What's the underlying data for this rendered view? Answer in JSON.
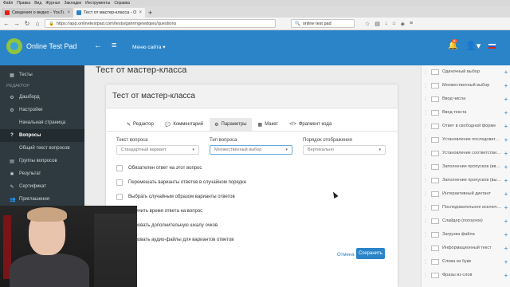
{
  "browser": {
    "menu": [
      "Файл",
      "Правка",
      "Вид",
      "Журнал",
      "Закладки",
      "Инструменты",
      "Справка"
    ],
    "tabs": [
      {
        "title": "Сведения о видео - YouTube S",
        "active": false,
        "color": "#e62117"
      },
      {
        "title": "Тест от мастер-класса - Onlin",
        "active": true,
        "color": "#2b84c7"
      }
    ],
    "url": "https://app.onlinetestpad.com/tests/gahrmgewdqwu/questions",
    "search_value": "online test pad"
  },
  "header": {
    "brand": "Online Test Pad",
    "site_menu": "Меню сайта",
    "notifications_count": "5",
    "accent_color": "#2b84c7"
  },
  "sidebar": {
    "items": [
      {
        "label": "Тесты",
        "icon": "list-icon",
        "active": false
      },
      {
        "section": "РЕДАКТОР"
      },
      {
        "label": "Дашборд",
        "icon": "gear-icon",
        "active": false
      },
      {
        "label": "Настройки",
        "icon": "gear-icon",
        "active": false
      },
      {
        "label": "Начальная страница",
        "icon": "page-icon",
        "active": false
      },
      {
        "label": "Вопросы",
        "icon": "question-icon",
        "active": true
      },
      {
        "label": "Общий текст вопросов",
        "icon": "text-icon",
        "active": false
      },
      {
        "label": "Группы вопросов",
        "icon": "group-icon",
        "active": false
      },
      {
        "label": "Результат",
        "icon": "result-icon",
        "active": false
      },
      {
        "label": "Сертификат",
        "icon": "certificate-icon",
        "active": false
      },
      {
        "label": "Приглашения",
        "icon": "invite-icon",
        "active": false
      }
    ]
  },
  "main": {
    "page_title": "Тест от мастер-класса",
    "card_title": "Тест от мастер-класса",
    "tabs": [
      {
        "label": "Редактор",
        "icon": "pencil-icon",
        "active": false
      },
      {
        "label": "Комментарий",
        "icon": "comment-icon",
        "active": false
      },
      {
        "label": "Параметры",
        "icon": "gear-icon",
        "active": true
      },
      {
        "label": "Макет",
        "icon": "layout-icon",
        "active": false
      },
      {
        "label": "Фрагмент кода",
        "icon": "code-icon",
        "active": false
      }
    ],
    "fields": {
      "text_question": {
        "label": "Текст вопроса",
        "value": "Стандартный вариант"
      },
      "question_type": {
        "label": "Тип вопроса",
        "value": "Множественный выбор"
      },
      "display_order": {
        "label": "Порядок отображения",
        "value": "Вертикально"
      }
    },
    "checkboxes": [
      {
        "label": "Обязателен ответ на этот вопрос",
        "checked": false
      },
      {
        "label": "Перемешать варианты ответов в случайном порядке",
        "checked": false
      },
      {
        "label": "Выбрать случайным образом варианты ответов",
        "checked": false
      },
      {
        "label": "…ничить время ответа на вопрос",
        "checked": false
      },
      {
        "label": "…ьзовать дополнительную шкалу очков",
        "checked": false
      },
      {
        "label": "…ьзовать аудио-файлы для вариантов ответов",
        "checked": false
      }
    ],
    "cancel_label": "Отмена",
    "save_label": "Сохранить"
  },
  "right_panel": {
    "items": [
      "Одиночный выбор",
      "Множественный выбор",
      "Ввод числа",
      "Ввод текста",
      "Ответ в свободной форме",
      "Установление последоват…",
      "Установление соответстви…",
      "Заполнение пропусков (вв…",
      "Заполнение пропусков (вы…",
      "Интерактивный диктант",
      "Последовательное исключ…",
      "Слайдер (ползунок)",
      "Загрузка файла",
      "Информационный текст",
      "Слова из букв",
      "Фразы из слов"
    ]
  }
}
